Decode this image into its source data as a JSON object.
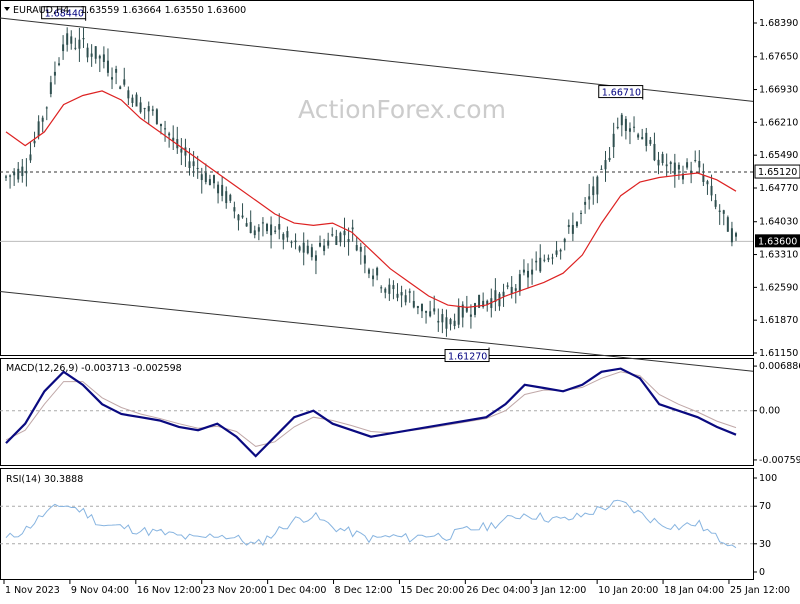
{
  "header": {
    "symbol": "EURAUD,H4",
    "ohlc": "1.63559 1.63664 1.63550 1.63600"
  },
  "watermark": "ActionForex.com",
  "price_panel": {
    "price_ticks": [
      "1.68390",
      "1.67650",
      "1.66930",
      "1.66210",
      "1.65490",
      "1.64770",
      "1.64030",
      "1.63310",
      "1.62590",
      "1.61870",
      "1.61150"
    ],
    "current_price_label": "1.63600",
    "resistance_label": "1.65120",
    "annotations": [
      {
        "text": "1.68440",
        "date": "6 Nov 2023",
        "price": 1.6844
      },
      {
        "text": "1.66710",
        "date": "16 Jan 2024",
        "price": 1.6671
      },
      {
        "text": "1.61270",
        "date": "28 Dec 2023",
        "price": 1.6127
      }
    ],
    "channel_upper": {
      "from": [
        0,
        1.685
      ],
      "to": [
        118,
        1.667
      ]
    },
    "channel_lower": {
      "from": [
        0,
        1.625
      ],
      "to": [
        96,
        1.611
      ]
    }
  },
  "macd_panel": {
    "label": "MACD(12,26,9) -0.003713 -0.002598",
    "ticks": [
      "0.006886",
      "0.00",
      "-0.007591"
    ]
  },
  "rsi_panel": {
    "label": "RSI(14) 30.3888",
    "ticks": [
      "100",
      "70",
      "30",
      "0"
    ]
  },
  "x_axis": {
    "labels": [
      "1 Nov 2023",
      "9 Nov 04:00",
      "16 Nov 12:00",
      "23 Nov 20:00",
      "1 Dec 04:00",
      "8 Dec 12:00",
      "15 Dec 20:00",
      "26 Dec 04:00",
      "3 Jan 12:00",
      "10 Jan 20:00",
      "18 Jan 04:00",
      "25 Jan 12:00"
    ]
  },
  "colors": {
    "candle": "#2f4f4f",
    "ma": "#dd2222",
    "macd": "#0a0a80",
    "signal": "#c0a8a8",
    "rsi": "#87b4e0",
    "grid": "#aaaaaa"
  },
  "chart_data": [
    {
      "type": "line",
      "title": "EURAUD,H4",
      "ylim": [
        1.6115,
        1.6875
      ],
      "x": [
        "1 Nov 2023",
        "3 Nov",
        "6 Nov",
        "8 Nov",
        "10 Nov",
        "13 Nov",
        "15 Nov",
        "17 Nov",
        "20 Nov",
        "22 Nov",
        "24 Nov",
        "27 Nov",
        "29 Nov",
        "1 Dec",
        "4 Dec",
        "6 Dec",
        "8 Dec",
        "11 Dec",
        "13 Dec",
        "15 Dec",
        "18 Dec",
        "20 Dec",
        "22 Dec",
        "26 Dec",
        "28 Dec",
        "1 Jan",
        "3 Jan",
        "5 Jan",
        "8 Jan",
        "10 Jan",
        "12 Jan",
        "15 Jan",
        "16 Jan",
        "18 Jan",
        "19 Jan",
        "22 Jan",
        "24 Jan",
        "26 Jan",
        "29 Jan"
      ],
      "series": [
        {
          "name": "close",
          "values": [
            1.65,
            1.652,
            1.664,
            1.68,
            1.679,
            1.676,
            1.671,
            1.666,
            1.663,
            1.656,
            1.652,
            1.648,
            1.643,
            1.638,
            1.639,
            1.635,
            1.633,
            1.637,
            1.638,
            1.63,
            1.625,
            1.624,
            1.62,
            1.618,
            1.621,
            1.623,
            1.624,
            1.628,
            1.632,
            1.636,
            1.642,
            1.65,
            1.663,
            1.66,
            1.654,
            1.651,
            1.653,
            1.644,
            1.636
          ]
        },
        {
          "name": "MA",
          "values": [
            1.66,
            1.657,
            1.66,
            1.666,
            1.668,
            1.669,
            1.667,
            1.663,
            1.66,
            1.657,
            1.654,
            1.651,
            1.648,
            1.645,
            1.642,
            1.64,
            1.6395,
            1.64,
            1.638,
            1.634,
            1.63,
            1.627,
            1.624,
            1.622,
            1.6215,
            1.622,
            1.624,
            1.6255,
            1.627,
            1.629,
            1.633,
            1.64,
            1.646,
            1.649,
            1.65,
            1.6505,
            1.651,
            1.6495,
            1.647
          ]
        }
      ]
    },
    {
      "type": "line",
      "title": "MACD(12,26,9)",
      "ylim": [
        -0.0076,
        0.0069
      ],
      "series": [
        {
          "name": "MACD",
          "values": [
            -0.005,
            -0.002,
            0.003,
            0.006,
            0.004,
            0.001,
            -0.0005,
            -0.001,
            -0.0015,
            -0.0025,
            -0.003,
            -0.002,
            -0.004,
            -0.007,
            -0.004,
            -0.001,
            0.0,
            -0.002,
            -0.003,
            -0.004,
            -0.0035,
            -0.003,
            -0.0025,
            -0.002,
            -0.0015,
            -0.001,
            0.001,
            0.004,
            0.0035,
            0.003,
            0.004,
            0.006,
            0.0065,
            0.005,
            0.001,
            0.0,
            -0.001,
            -0.0025,
            -0.0037
          ]
        },
        {
          "name": "Signal",
          "values": [
            -0.0045,
            -0.003,
            0.001,
            0.0045,
            0.0045,
            0.002,
            0.0005,
            -0.0005,
            -0.0012,
            -0.002,
            -0.0027,
            -0.0024,
            -0.0032,
            -0.0055,
            -0.0048,
            -0.0025,
            -0.001,
            -0.0015,
            -0.0023,
            -0.0032,
            -0.0034,
            -0.0031,
            -0.0027,
            -0.0022,
            -0.0017,
            -0.0012,
            0.0,
            0.0025,
            0.0032,
            0.0031,
            0.0036,
            0.005,
            0.006,
            0.0054,
            0.0025,
            0.001,
            -0.0002,
            -0.0016,
            -0.0026
          ]
        }
      ]
    },
    {
      "type": "line",
      "title": "RSI(14)",
      "ylim": [
        0,
        100
      ],
      "series": [
        {
          "name": "RSI",
          "values": [
            35,
            45,
            62,
            72,
            65,
            50,
            48,
            44,
            42,
            38,
            35,
            40,
            36,
            28,
            42,
            55,
            60,
            48,
            42,
            35,
            38,
            36,
            40,
            38,
            45,
            48,
            55,
            62,
            58,
            55,
            60,
            68,
            74,
            62,
            52,
            48,
            52,
            36,
            30
          ]
        }
      ]
    }
  ]
}
